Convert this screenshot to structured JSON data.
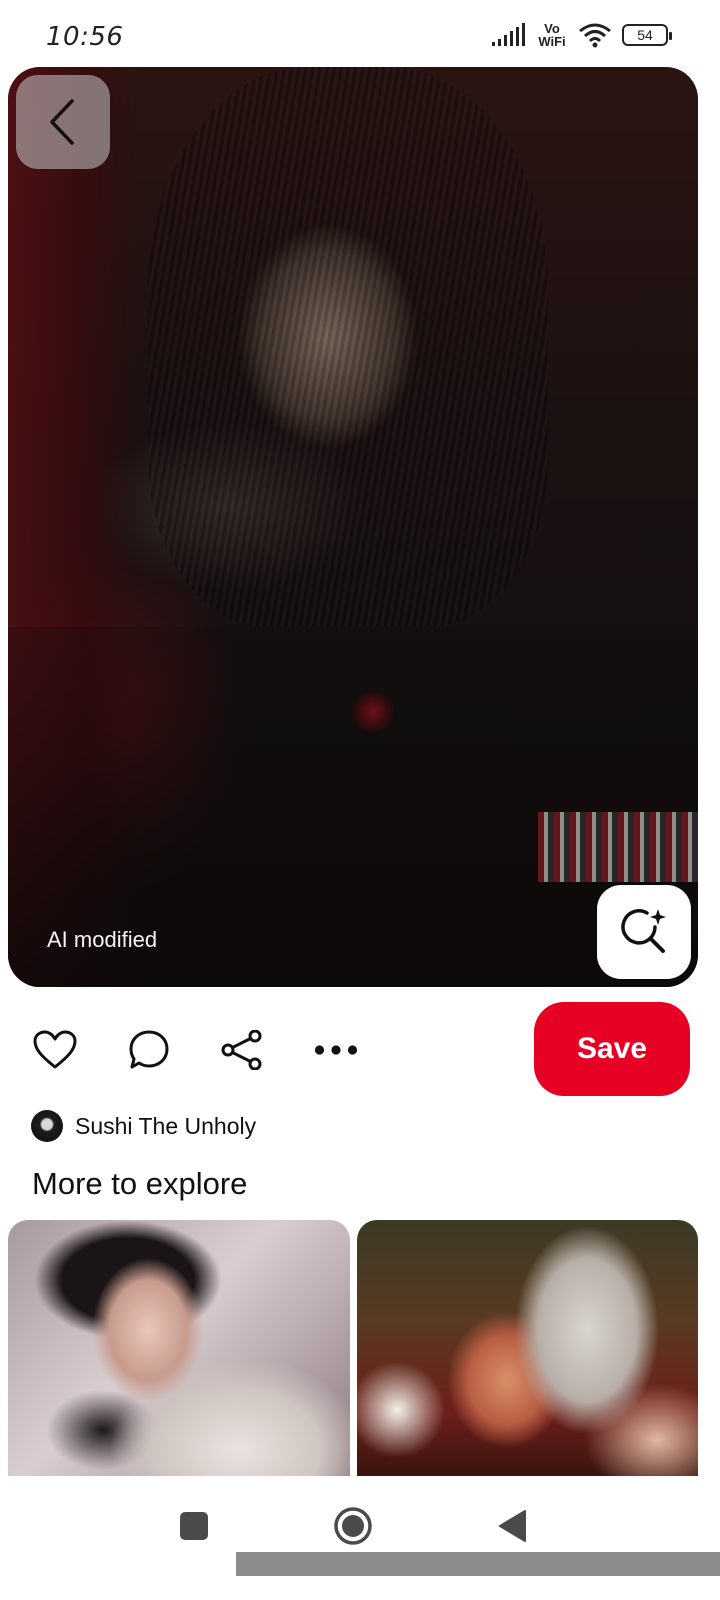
{
  "status_bar": {
    "time": "10:56",
    "network_label": "Vo WiFi",
    "battery": "54",
    "icons": [
      "signal-icon",
      "wifi-icon",
      "battery-icon"
    ]
  },
  "pin": {
    "ai_label": "AI modified",
    "save_label": "Save",
    "creator_name": "Sushi The Unholy",
    "icons": [
      "chevron-left-icon",
      "visual-search-icon",
      "heart-icon",
      "comment-icon",
      "share-icon",
      "more-icon"
    ]
  },
  "explore": {
    "title": "More to explore",
    "items": [
      {
        "thumbnail": "dark-haired man in white uniform"
      },
      {
        "thumbnail": "silver-haired man embracing red-haired woman"
      }
    ]
  },
  "nav": {
    "icons": [
      "square-icon",
      "circle-icon",
      "triangle-back-icon"
    ]
  },
  "colors": {
    "accent": "#e60023",
    "text": "#111111",
    "background": "#ffffff"
  }
}
